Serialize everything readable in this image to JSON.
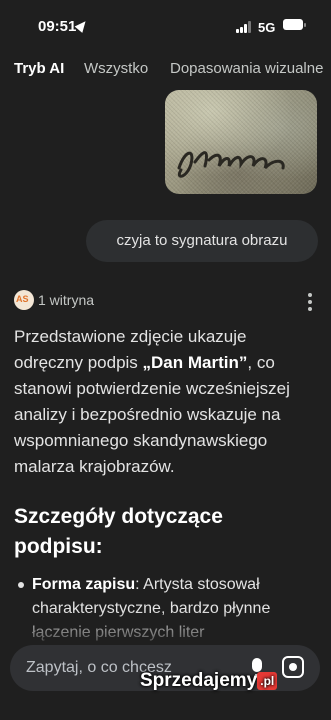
{
  "status": {
    "time": "09:51",
    "network": "5G"
  },
  "tabs": [
    {
      "label": "Tryb AI",
      "active": true
    },
    {
      "label": "Wszystko",
      "active": false
    },
    {
      "label": "Dopasowania wizualne",
      "active": false
    }
  ],
  "user_message": "czyja to sygnatura obrazu",
  "source": {
    "label": "1 witryna"
  },
  "answer": {
    "p1_start": "Przedstawione zdjęcie ukazuje odręczny podpis ",
    "p1_bold": "„Dan Martin”",
    "p1_end": ", co stanowi potwierdzenie wcześniejszej analizy i bezpośrednio wskazuje na wspomnianego skandynawskiego malarza krajobrazów."
  },
  "section_heading": "Szczegóły dotyczące podpisu:",
  "bullet": {
    "label": "Forma zapisu",
    "text": ": Artysta stosował charakterystyczne, bardzo płynne łączenie pierwszych liter"
  },
  "search": {
    "placeholder": "Zapytaj, o co chcesz"
  },
  "watermark": {
    "text": "Sprzedajemy",
    "badge": ".pl"
  },
  "icons": [
    "location-arrow-icon",
    "signal-icon",
    "battery-icon",
    "more-vert-icon",
    "mic-icon",
    "lens-icon",
    "source-favicon-icon"
  ]
}
